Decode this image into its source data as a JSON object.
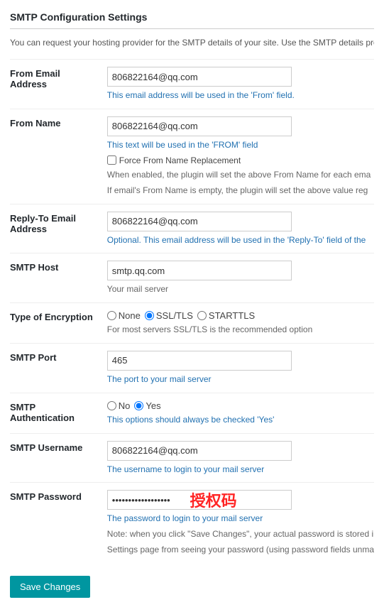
{
  "page": {
    "title": "SMTP Configuration Settings",
    "intro": "You can request your hosting provider for the SMTP details of your site. Use the SMTP details provide"
  },
  "form": {
    "from_email": {
      "label": "From Email Address",
      "value": "806822164@qq.com",
      "hint": "This email address will be used in the 'From' field."
    },
    "from_name": {
      "label": "From Name",
      "value": "806822164@qq.com",
      "hint": "This text will be used in the 'FROM' field",
      "checkbox_label": "Force From Name Replacement",
      "checkbox_hint1": "When enabled, the plugin will set the above From Name for each ema",
      "checkbox_hint2": "If email's From Name is empty, the plugin will set the above value reg"
    },
    "reply_to": {
      "label": "Reply-To Email Address",
      "value": "806822164@qq.com",
      "hint": "Optional. This email address will be used in the 'Reply-To' field of the"
    },
    "smtp_host": {
      "label": "SMTP Host",
      "value": "smtp.qq.com",
      "hint": "Your mail server"
    },
    "encryption": {
      "label": "Type of Encryption",
      "options": [
        "None",
        "SSL/TLS",
        "STARTTLS"
      ],
      "selected": "SSL/TLS",
      "hint": "For most servers SSL/TLS is the recommended option"
    },
    "smtp_port": {
      "label": "SMTP Port",
      "value": "465",
      "hint": "The port to your mail server"
    },
    "smtp_auth": {
      "label": "SMTP Authentication",
      "options": [
        "No",
        "Yes"
      ],
      "selected": "Yes",
      "hint": "This options should always be checked 'Yes'"
    },
    "smtp_username": {
      "label": "SMTP Username",
      "value": "806822164@qq.com",
      "hint": "The username to login to your mail server"
    },
    "smtp_password": {
      "label": "SMTP Password",
      "value": "••••••••••••••••••",
      "watermark": "授权码",
      "hint": "The password to login to your mail server",
      "note1": "Note: when you click \"Save Changes\", your actual password is stored i",
      "note2": "Settings page from seeing your password (using password fields unma"
    }
  },
  "buttons": {
    "save": "Save Changes"
  }
}
